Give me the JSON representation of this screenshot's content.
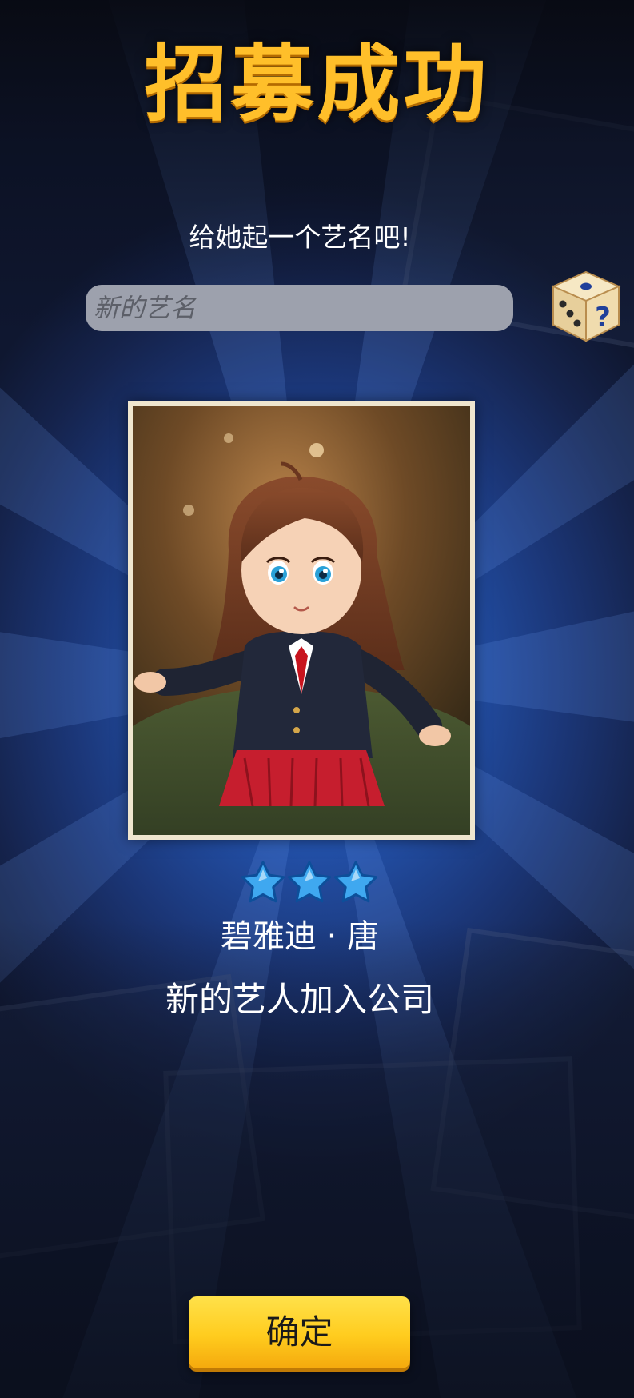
{
  "header": {
    "title": "招募成功"
  },
  "naming": {
    "prompt": "给她起一个艺名吧!",
    "input_value": "",
    "input_placeholder": "新的艺名",
    "random_button_icon": "dice-question-icon"
  },
  "recruit": {
    "portrait_icon": "artist-portrait",
    "star_count": 3,
    "star_max": 3,
    "artist_name": "碧雅迪 · 唐",
    "message": "新的艺人加入公司"
  },
  "actions": {
    "confirm_label": "确定"
  },
  "colors": {
    "title": "#ffbf2a",
    "button": "#ffcc1e",
    "star": "#3fa8f0",
    "background": "#224fa6"
  }
}
